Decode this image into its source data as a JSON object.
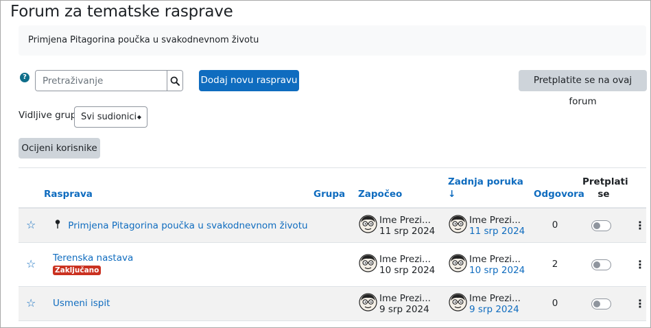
{
  "page_title": "Forum za tematske rasprave",
  "intro_text": "Primjena Pitagorina poučka u svakodnevnom životu",
  "help_icon": "?",
  "search": {
    "placeholder": "Pretraživanje",
    "icon": "search-icon"
  },
  "add_discussion_label": "Dodaj novu raspravu",
  "subscribe_forum_label": "Pretplatite se na ovaj forum",
  "groups": {
    "label": "Vidljive grupe",
    "selected": "Svi sudionici",
    "caret": "◆"
  },
  "grade_users_label": "Ocijeni korisnike",
  "columns": {
    "discussion": "Rasprava",
    "group": "Grupa",
    "started": "Započeo",
    "last_post_line1": "Zadnja poruka",
    "last_post_arrow": "↓",
    "replies": "Odgovora",
    "subscribe_line1": "Pretplati",
    "subscribe_line2": "se"
  },
  "accent_color": "#0f6cbf",
  "discussions": [
    {
      "title": "Primjena Pitagorina poučka u svakodnevnom životu",
      "pinned": true,
      "badge": "",
      "started_by": "Ime Prezi...",
      "started_date": "11 srp 2024",
      "last_by": "Ime Prezi...",
      "last_date": "11 srp 2024",
      "replies": "0",
      "subscribed": false,
      "star": "☆",
      "menu": "⋮"
    },
    {
      "title": "Terenska nastava",
      "pinned": false,
      "badge": "Zaključano",
      "started_by": "Ime Prezi...",
      "started_date": "10 srp 2024",
      "last_by": "Ime Prezi...",
      "last_date": "10 srp 2024",
      "replies": "2",
      "subscribed": false,
      "star": "☆",
      "menu": "⋮"
    },
    {
      "title": "Usmeni ispit",
      "pinned": false,
      "badge": "",
      "started_by": "Ime Prezi...",
      "started_date": "9 srp 2024",
      "last_by": "Ime Prezi...",
      "last_date": "9 srp 2024",
      "replies": "0",
      "subscribed": false,
      "star": "☆",
      "menu": "⋮"
    }
  ]
}
